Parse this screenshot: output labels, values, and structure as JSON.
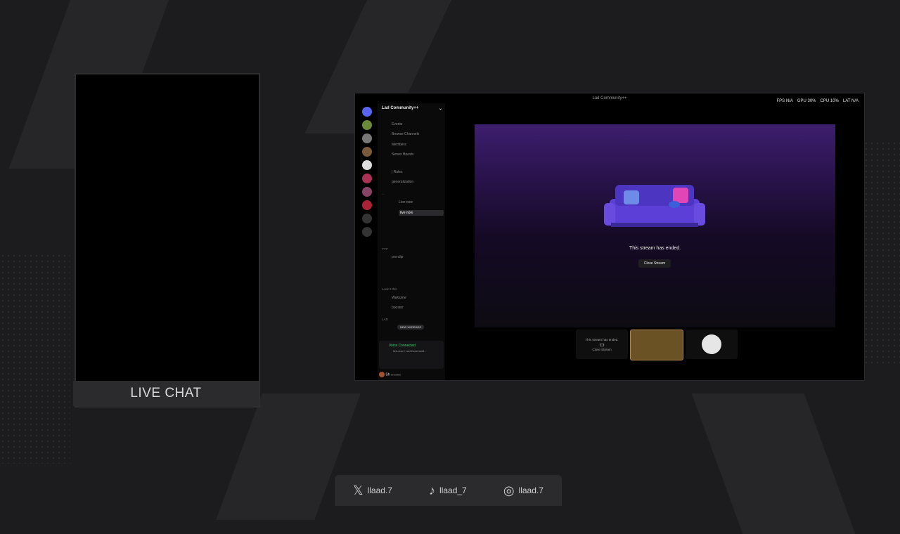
{
  "chat": {
    "label": "LIVE CHAT"
  },
  "discord": {
    "window_title": "Lad Community++",
    "perf": [
      "FPS N/A",
      "GPU 30%",
      "CPU 10%",
      "LAT N/A"
    ],
    "server_name": "Lad Community++",
    "channels": [
      {
        "label": "Events"
      },
      {
        "label": "Browse Channels"
      },
      {
        "label": "Members"
      },
      {
        "label": "Server Boosts"
      },
      {
        "label": "| Rules"
      },
      {
        "label": "generalization"
      },
      {
        "label": "Live-now"
      },
      {
        "label": "live now"
      },
      {
        "label": "pro-clip"
      },
      {
        "label": "Welcome"
      },
      {
        "label": "booster"
      }
    ],
    "categories": [
      "...",
      "TTT",
      "Look it this",
      "LAD"
    ],
    "new_unreads": "NEW UNREADS",
    "voice": {
      "status": "Voice Connected",
      "sub": "live-now / Lad Communit..."
    },
    "user": {
      "name": "Sh",
      "status": "Invisible"
    },
    "stream": {
      "ended_text": "This stream has ended.",
      "close_label": "Close Stream"
    },
    "thumb_text": "This stream has ended.",
    "thumb_close": "Close Stream"
  },
  "social": [
    {
      "icon": "x-icon",
      "handle": "llaad.7"
    },
    {
      "icon": "tiktok-icon",
      "handle": "llaad_7"
    },
    {
      "icon": "instagram-icon",
      "handle": "llaad.7"
    }
  ]
}
